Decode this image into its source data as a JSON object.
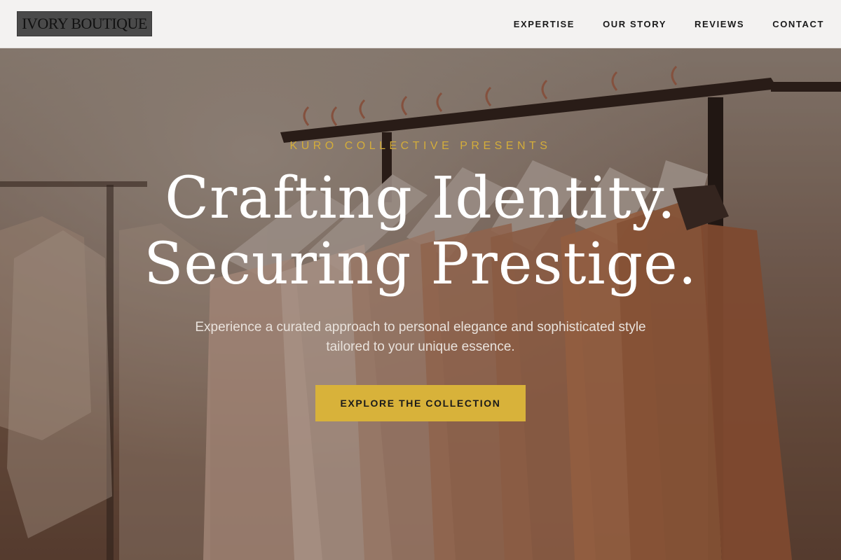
{
  "brand": {
    "logo_text": "IVORY BOUTIQUE"
  },
  "nav": {
    "items": [
      {
        "label": "EXPERTISE"
      },
      {
        "label": "OUR STORY"
      },
      {
        "label": "REVIEWS"
      },
      {
        "label": "CONTACT"
      }
    ]
  },
  "hero": {
    "eyebrow": "KURO COLLECTIVE PRESENTS",
    "headline_line1": "Crafting Identity.",
    "headline_line2": "Securing Prestige.",
    "subtitle": "Experience a curated approach to personal elegance and sophisticated style tailored to your unique essence.",
    "cta_label": "EXPLORE THE COLLECTION",
    "background_image": "clothing-rack-photo"
  },
  "colors": {
    "accent_gold": "#d8b23a",
    "header_bg": "#f3f2f1",
    "logo_bg": "#4a4a4a"
  }
}
